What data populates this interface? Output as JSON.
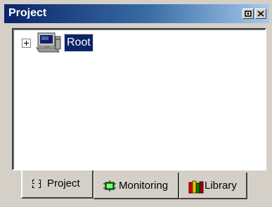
{
  "window": {
    "title": "Project",
    "dock_button_icon": "dock-icon",
    "close_button_icon": "close-icon"
  },
  "tree": {
    "nodes": [
      {
        "label": "Root",
        "icon": "computer-icon",
        "expanded": false,
        "selected": true
      }
    ]
  },
  "tabs": [
    {
      "label": "Project",
      "icon": "project-tree-icon",
      "active": true
    },
    {
      "label": "Monitoring",
      "icon": "monitoring-icon",
      "active": false
    },
    {
      "label": "Library",
      "icon": "library-books-icon",
      "active": false
    }
  ],
  "colors": {
    "titlebar_start": "#0a246a",
    "titlebar_end": "#a6caf0",
    "selection": "#0a246a",
    "face": "#d4d0c8"
  }
}
